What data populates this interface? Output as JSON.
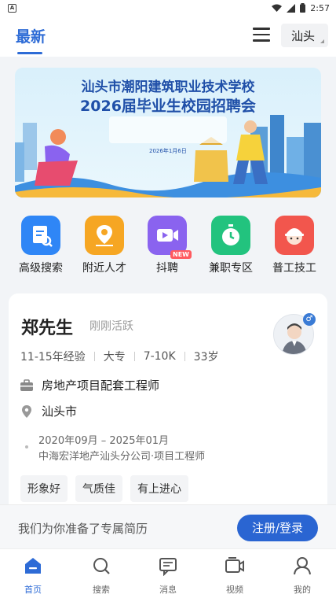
{
  "status_bar": {
    "time": "2:57"
  },
  "header": {
    "tab_latest": "最新",
    "city": "汕头"
  },
  "banner": {
    "title_line1": "汕头市潮阳建筑职业技术学校",
    "title_line2": "2026届毕业生校园招聘会",
    "date": "2026年1月6日"
  },
  "quick_entries": [
    {
      "label": "高级搜索",
      "icon": "search-doc-icon",
      "color": "#2f86f6"
    },
    {
      "label": "附近人才",
      "icon": "map-pin-icon",
      "color": "#f6a623"
    },
    {
      "label": "抖聘",
      "icon": "video-icon",
      "color": "#8a63ef",
      "badge": "NEW"
    },
    {
      "label": "兼职专区",
      "icon": "stopwatch-icon",
      "color": "#22c37e"
    },
    {
      "label": "普工技工",
      "icon": "worker-icon",
      "color": "#f2564d"
    }
  ],
  "candidate": {
    "name": "郑先生",
    "active": "刚刚活跃",
    "experience": "11-15年经验",
    "education": "大专",
    "salary": "7-10K",
    "age": "33岁",
    "position": "房地产项目配套工程师",
    "city": "汕头市",
    "work_period": "2020年09月 – 2025年01月",
    "work_company": "中海宏洋地产汕头分公司·项目工程师",
    "tags": [
      "形象好",
      "气质佳",
      "有上进心"
    ]
  },
  "register_bar": {
    "text": "我们为你准备了专属简历",
    "button": "注册/登录"
  },
  "bottom_nav": [
    {
      "label": "首页",
      "icon": "home-icon"
    },
    {
      "label": "搜索",
      "icon": "search-icon"
    },
    {
      "label": "消息",
      "icon": "message-icon"
    },
    {
      "label": "视频",
      "icon": "video-icon"
    },
    {
      "label": "我的",
      "icon": "profile-icon"
    }
  ],
  "colors": {
    "primary": "#2d6bd6",
    "button": "#2a65d2"
  }
}
